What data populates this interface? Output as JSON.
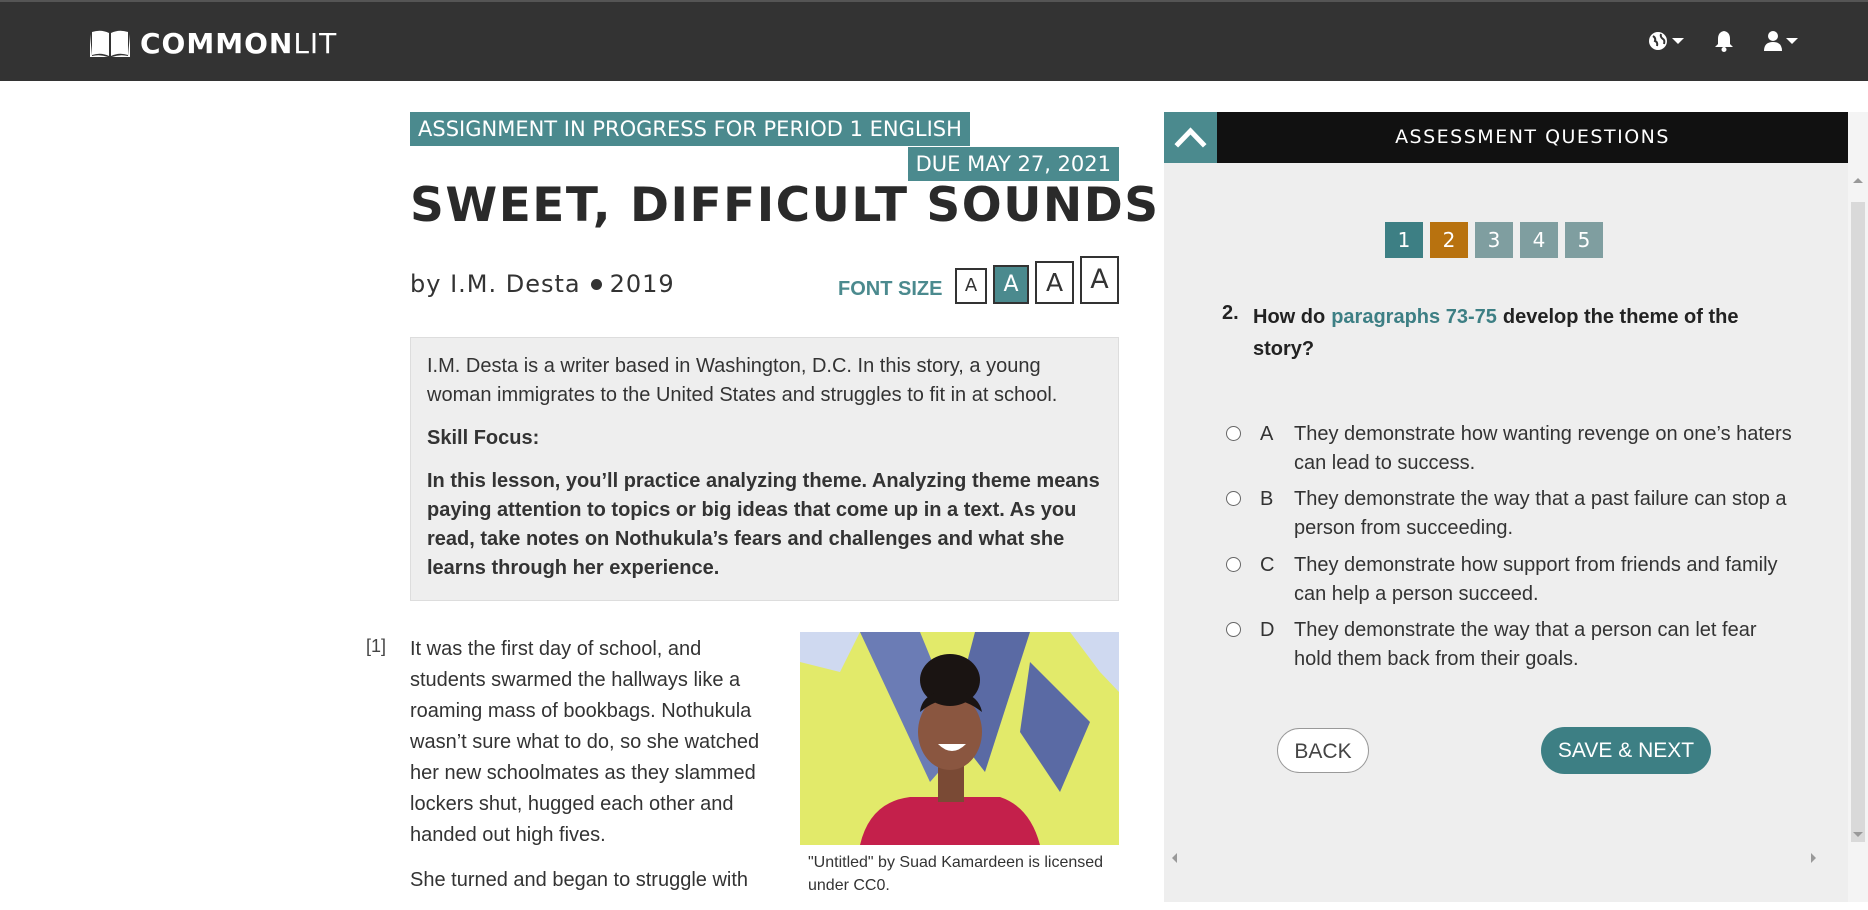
{
  "header": {
    "logo_bold": "COMMON",
    "logo_light": "LIT",
    "icons": [
      "book-icon",
      "globe-icon",
      "bell-icon",
      "user-icon"
    ]
  },
  "assignment": {
    "status": "ASSIGNMENT IN PROGRESS FOR PERIOD 1 ENGLISH",
    "due": "DUE MAY 27, 2021"
  },
  "article": {
    "title": "SWEET, DIFFICULT SOUNDS",
    "author": "by I.M. Desta",
    "year": "2019",
    "font_size_label": "FONT SIZE",
    "font_size_options": [
      "A",
      "A",
      "A",
      "A"
    ],
    "font_size_selected": 1,
    "intro": "I.M. Desta is a writer based in Washington, D.C. In this story, a young woman immigrates to the United States and struggles to fit in at school.",
    "skill_focus_label": "Skill Focus:",
    "skill_focus_text": "In this lesson, you’ll practice analyzing theme. Analyzing theme means paying attention to topics or big ideas that come up in a text. As you read, take notes on Nothukula’s fears and challenges and what she learns through her experience.",
    "paragraph_number": "[1]",
    "paragraph_1": "It was the first day of school, and students swarmed the hallways like a roaming mass of bookbags. Nothukula wasn’t sure what to do, so she watched her new schoolmates as they slammed lockers shut, hugged each other and handed out high fives.",
    "paragraph_2": "She turned and began to struggle with",
    "image_caption": "\"Untitled\" by Suad Kamardeen is licensed under CC0."
  },
  "panel": {
    "title": "ASSESSMENT QUESTIONS",
    "question_numbers": [
      "1",
      "2",
      "3",
      "4",
      "5"
    ],
    "current_question": 2,
    "question_label": "2.",
    "question_prefix": "How do",
    "question_link": "paragraphs 73-75",
    "question_suffix": "develop the theme of the story?",
    "options": [
      {
        "letter": "A",
        "text": "They demonstrate how wanting revenge on one’s haters can lead to success."
      },
      {
        "letter": "B",
        "text": "They demonstrate the way that a past failure can stop a person from succeeding."
      },
      {
        "letter": "C",
        "text": "They demonstrate how support from friends and family can help a person succeed."
      },
      {
        "letter": "D",
        "text": "They demonstrate the way that a person can let fear hold them back from their goals."
      }
    ],
    "back_label": "BACK",
    "next_label": "SAVE & NEXT"
  },
  "colors": {
    "topbar": "#333333",
    "accent_teal": "#4b8a8e",
    "current_question": "#b8720f",
    "panel_bg": "#eeeeee"
  }
}
